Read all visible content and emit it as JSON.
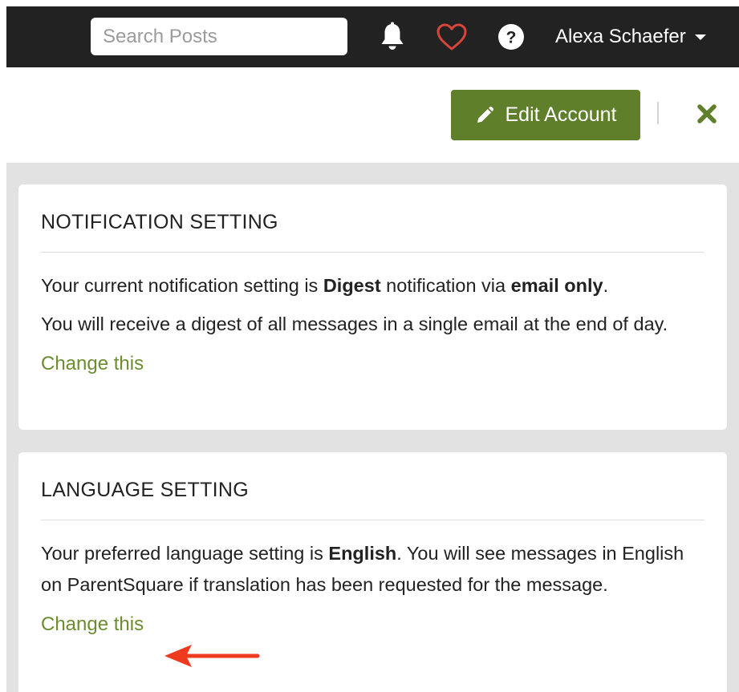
{
  "topbar": {
    "search_placeholder": "Search Posts",
    "icons": [
      "bell-icon",
      "heart-icon",
      "help-icon"
    ],
    "user_name": "Alexa Schaefer"
  },
  "header": {
    "edit_account_label": "Edit Account"
  },
  "notification_setting": {
    "title": "NOTIFICATION SETTING",
    "line1_prefix": "Your current notification setting is ",
    "line1_setting": "Digest",
    "line1_middle": " notification via ",
    "line1_channel": "email only",
    "line1_suffix": ".",
    "line2": "You will receive a digest of all messages in a single email at the end of day.",
    "change_label": "Change this"
  },
  "language_setting": {
    "title": "LANGUAGE SETTING",
    "line1_prefix": "Your preferred language setting is ",
    "line1_language": "English",
    "line1_suffix": ". You will see messages in English on ParentSquare if translation has been requested for the message.",
    "change_label": "Change this"
  },
  "colors": {
    "topbar": "#222222",
    "primary_green": "#5f7f2b",
    "link_green": "#6b8d2f",
    "heart_red": "#d8463b",
    "annotation_arrow": "#ee3b1f",
    "page_gray": "#e2e2e2"
  }
}
